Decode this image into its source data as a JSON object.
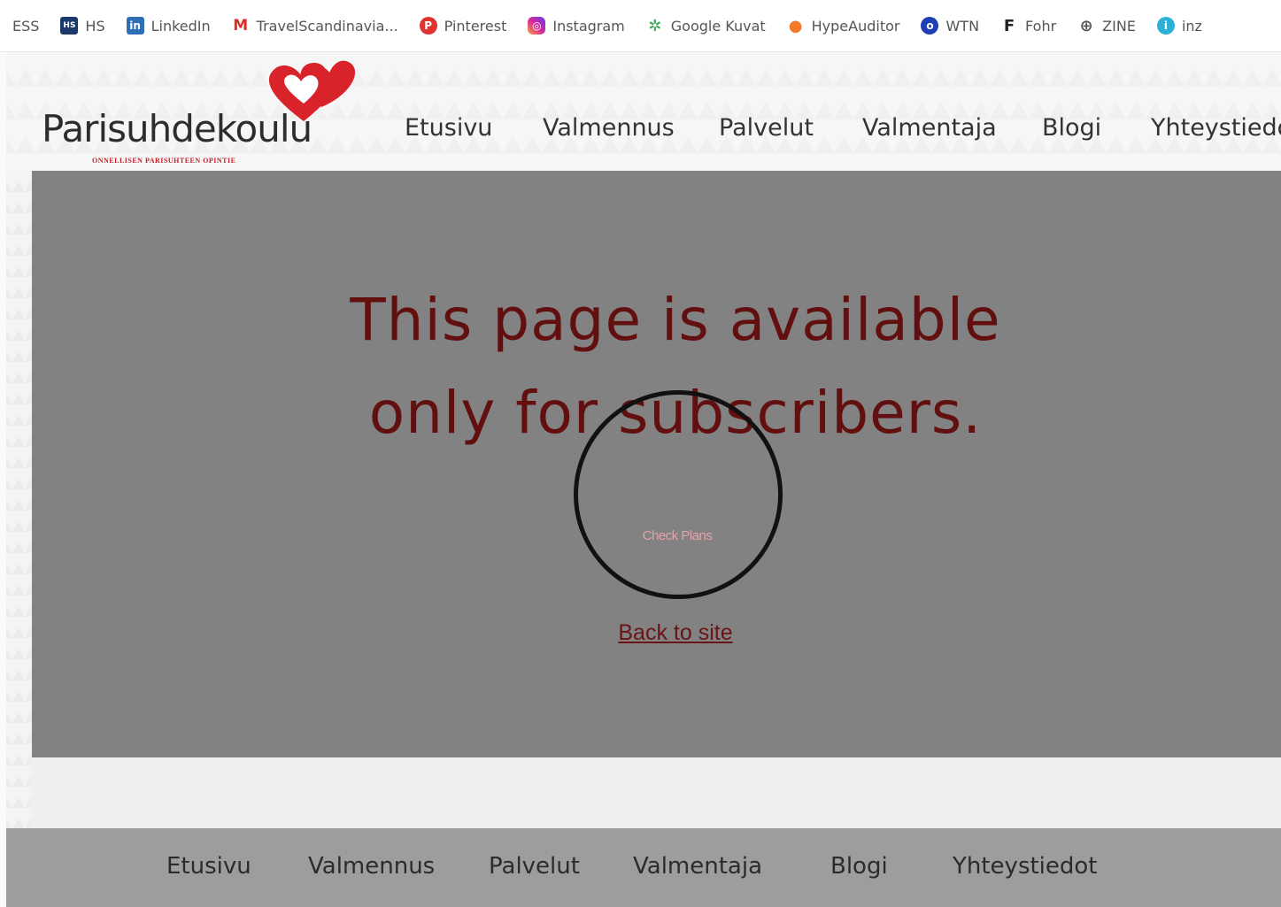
{
  "bookmarks": [
    {
      "label": "ESS",
      "icon": "none"
    },
    {
      "label": "HS",
      "icon": "hs-icon",
      "glyph": "HS"
    },
    {
      "label": "LinkedIn",
      "icon": "linkedin-icon",
      "glyph": "in"
    },
    {
      "label": "TravelScandinavia...",
      "icon": "gmail-icon",
      "glyph": "M"
    },
    {
      "label": "Pinterest",
      "icon": "pinterest-icon",
      "glyph": "P"
    },
    {
      "label": "Instagram",
      "icon": "instagram-icon",
      "glyph": "◎"
    },
    {
      "label": "Google Kuvat",
      "icon": "google-photos-icon",
      "glyph": "✲"
    },
    {
      "label": "HypeAuditor",
      "icon": "hypeauditor-icon",
      "glyph": "●"
    },
    {
      "label": "WTN",
      "icon": "wtn-icon",
      "glyph": "o"
    },
    {
      "label": "Fohr",
      "icon": "fohr-icon",
      "glyph": "F"
    },
    {
      "label": "ZINE",
      "icon": "globe-icon",
      "glyph": "⊕"
    },
    {
      "label": "inz",
      "icon": "inz-icon",
      "glyph": "i"
    }
  ],
  "site": {
    "logo_text": "Parisuhdekoulu",
    "tagline": "ONNELLISEN PARISUHTEEN OPINTIE",
    "nav": [
      "Etusivu",
      "Valmennus",
      "Palvelut",
      "Valmentaja",
      "Blogi",
      "Yhteystiedot"
    ]
  },
  "paywall": {
    "message_line1": "This page is available",
    "message_line2": "only for subscribers.",
    "check_plans": "Check Plans",
    "back_link": "Back to site"
  },
  "footer": {
    "nav": [
      "Etusivu",
      "Valmennus",
      "Palvelut",
      "Valmentaja",
      "Blogi",
      "Yhteystiedot"
    ]
  },
  "colors": {
    "overlay": "#828282",
    "message": "#620f10",
    "heart": "#d8232a",
    "footer": "#9d9d9d"
  }
}
